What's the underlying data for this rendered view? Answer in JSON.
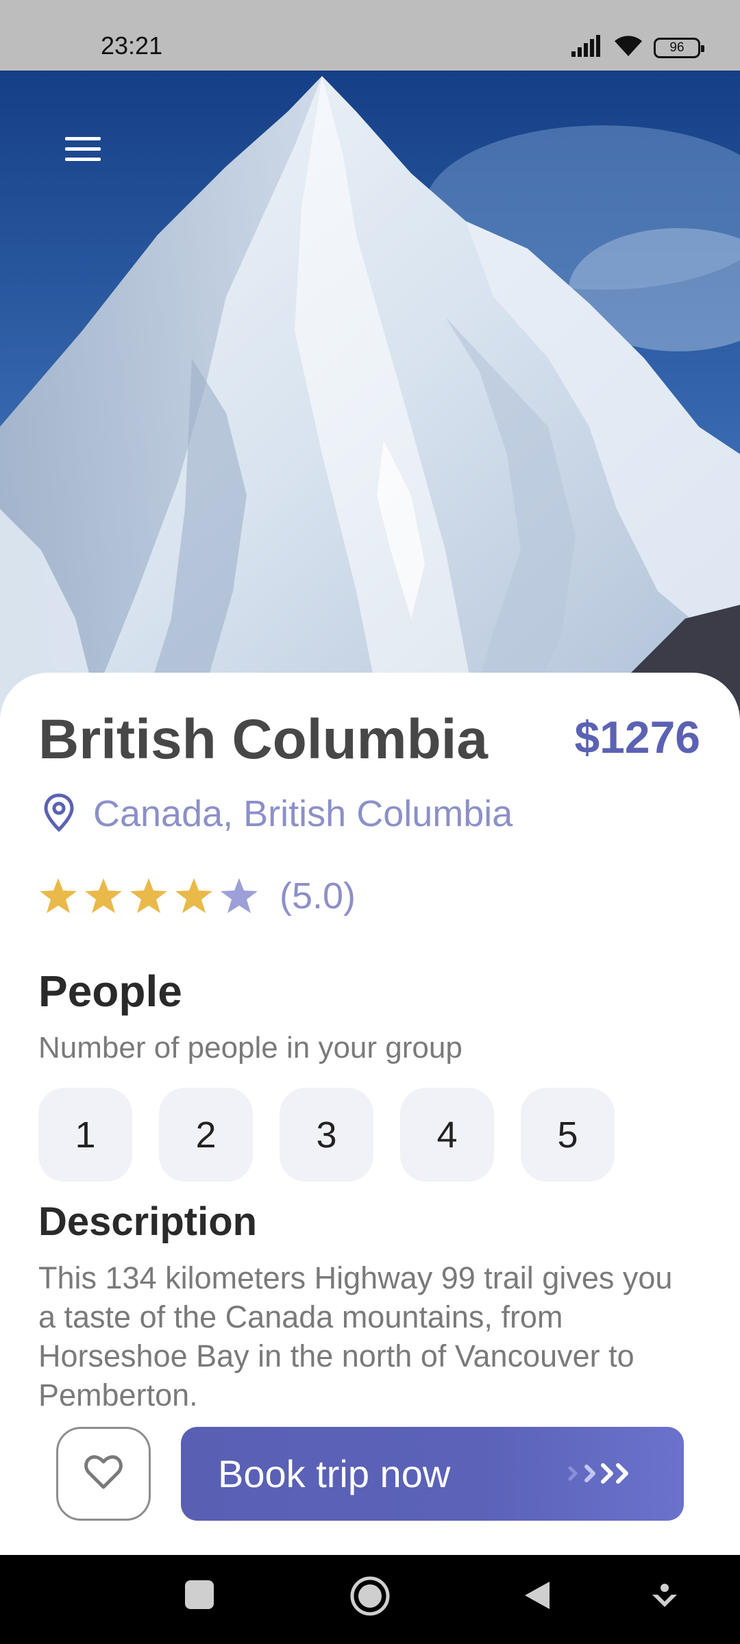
{
  "status_bar": {
    "time": "23:21",
    "battery": "96",
    "icons": [
      "signal-icon",
      "wifi-icon",
      "battery-icon"
    ]
  },
  "header": {
    "menu_icon": "hamburger-menu-icon",
    "hero_image": "snowy mountain peak photo"
  },
  "trip": {
    "title": "British Columbia",
    "price": "$1276",
    "location": "Canada, British Columbia",
    "location_icon": "map-pin-icon",
    "rating": {
      "stars_filled": 4,
      "stars_total": 5,
      "text": "(5.0)"
    }
  },
  "people": {
    "title": "People",
    "subtitle": "Number of people in your group",
    "options": [
      "1",
      "2",
      "3",
      "4",
      "5"
    ]
  },
  "description": {
    "title": "Description",
    "text": "This 134 kilometers Highway 99 trail gives you a taste of the Canada mountains, from Horseshoe Bay in the north of Vancouver to Pemberton."
  },
  "actions": {
    "favorite_icon": "heart-icon",
    "book_label": "Book trip now",
    "book_arrows_icon": "chevrons-right-icon"
  },
  "nav_bar": {
    "buttons": [
      "recents-icon",
      "home-icon",
      "back-icon",
      "assistant-icon"
    ]
  },
  "colors": {
    "accent": "#5b62b3",
    "accent_light": "#8c90c8",
    "star_gold": "#e9b949",
    "star_empty": "#9c9fd8",
    "chip_bg": "#f1f1f8"
  }
}
